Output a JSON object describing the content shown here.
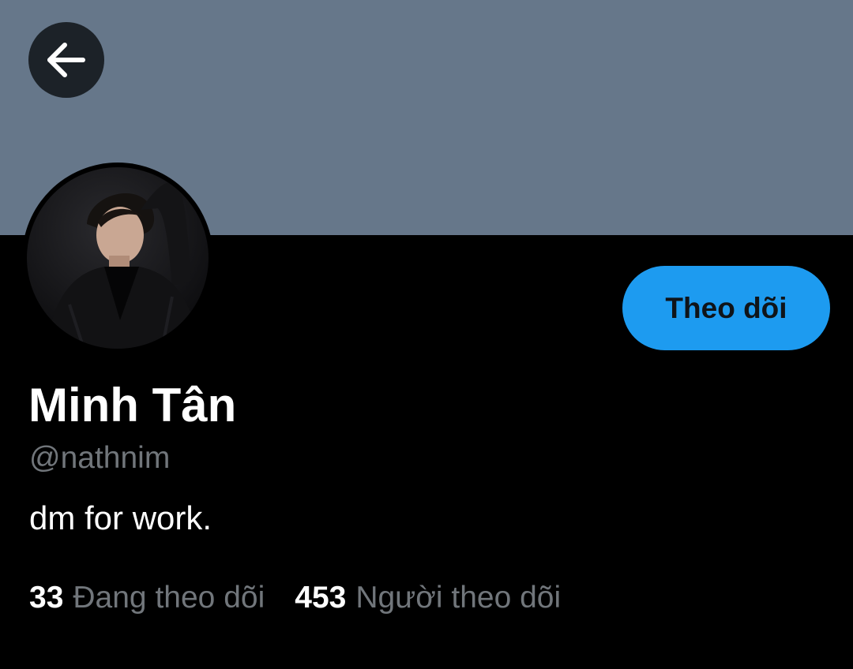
{
  "colors": {
    "banner": "#66778a",
    "background": "#000000",
    "accent": "#1d9bf0",
    "text_primary": "#ffffff",
    "text_secondary": "#71767b",
    "back_button_bg": "#1c2228"
  },
  "header": {
    "back_icon": "arrow-left-icon"
  },
  "profile": {
    "display_name": "Minh Tân",
    "handle": "@nathnim",
    "bio": "dm for work.",
    "avatar": "profile-photo"
  },
  "actions": {
    "follow_label": "Theo dõi"
  },
  "stats": {
    "following_count": "33",
    "following_label": "Đang theo dõi",
    "followers_count": "453",
    "followers_label": "Người theo dõi"
  }
}
